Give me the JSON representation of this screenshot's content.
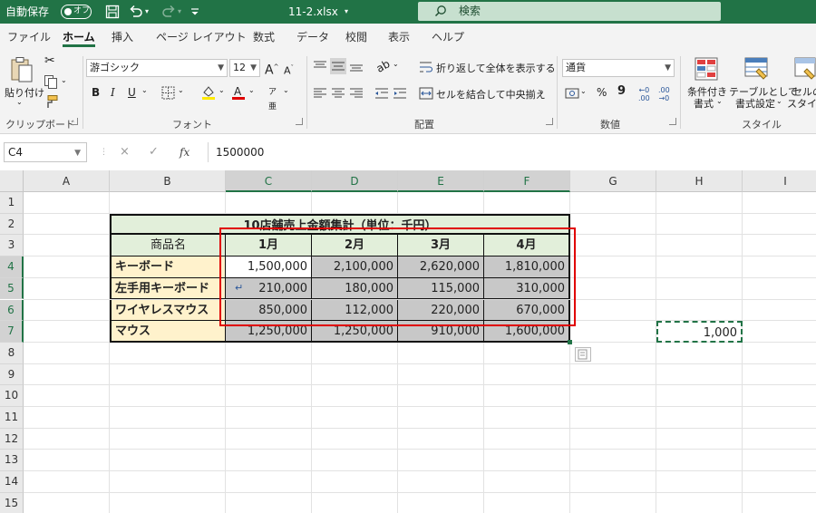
{
  "titlebar": {
    "autosave_label": "自動保存",
    "autosave_state": "オフ",
    "filename": "11-2.xlsx",
    "search_placeholder": "検索"
  },
  "tabs": [
    "ファイル",
    "ホーム",
    "挿入",
    "ページ レイアウト",
    "数式",
    "データ",
    "校閲",
    "表示",
    "ヘルプ"
  ],
  "ribbon": {
    "paste_label": "貼り付け",
    "clipboard_group": "クリップボード",
    "font_name": "游ゴシック",
    "font_size": "12",
    "font_group": "フォント",
    "bold": "B",
    "italic": "I",
    "underline": "U",
    "wrap_text": "折り返して全体を表示する",
    "merge_center": "セルを結合して中央揃え",
    "alignment_group": "配置",
    "number_format": "通貨",
    "percent": "%",
    "comma": "9",
    "number_group": "数値",
    "conditional_format": "条件付き\n書式",
    "conditional_format_l1": "条件付き",
    "conditional_format_l2": "書式",
    "format_as_table_l1": "テーブルとして",
    "format_as_table_l2": "書式設定",
    "cell_styles_l1": "セルの",
    "cell_styles_l2": "スタイル",
    "styles_group": "スタイル"
  },
  "formula_bar": {
    "name_box": "C4",
    "cancel": "×",
    "enter": "✓",
    "fx": "fx",
    "value": "1500000"
  },
  "columns": [
    "A",
    "B",
    "C",
    "D",
    "E",
    "F",
    "G",
    "H",
    "I"
  ],
  "rows": [
    "1",
    "2",
    "3",
    "4",
    "5",
    "6",
    "7",
    "8",
    "9",
    "10",
    "11",
    "12",
    "13",
    "14",
    "15"
  ],
  "sheet": {
    "table_title": "10店舗売上金額集計（単位：千円）",
    "header_product": "商品名",
    "months": [
      "1月",
      "2月",
      "3月",
      "4月"
    ],
    "products": [
      "キーボード",
      "左手用キーボード",
      "ワイヤレスマウス",
      "マウス"
    ],
    "values": [
      [
        "1,500,000",
        "2,100,000",
        "2,620,000",
        "1,810,000"
      ],
      [
        "210,000",
        "180,000",
        "115,000",
        "310,000"
      ],
      [
        "850,000",
        "112,000",
        "220,000",
        "670,000"
      ],
      [
        "1,250,000",
        "1,250,000",
        "910,000",
        "1,600,000"
      ]
    ],
    "h7_value": "1,000"
  },
  "colors": {
    "excel_green": "#217346",
    "selection_gray": "#c8c8c8",
    "title_fill": "#e2efda",
    "product_fill": "#fff2cc",
    "highlight_border": "#e00000"
  }
}
